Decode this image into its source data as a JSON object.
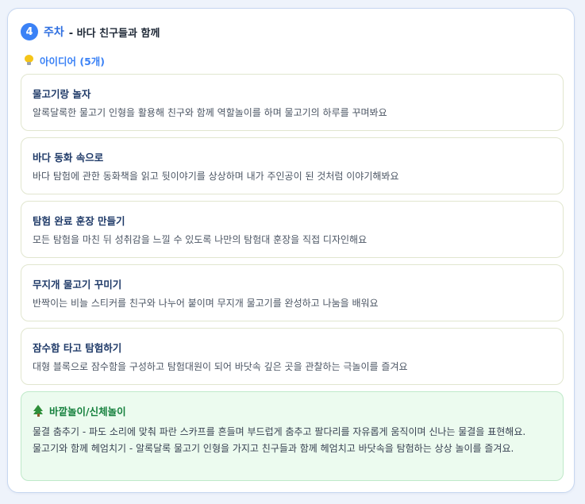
{
  "week": {
    "number": "4",
    "label": "주차",
    "title": "- 바다 친구들과 함께"
  },
  "ideas": {
    "header": "아이디어 (5개)",
    "icon": "lightbulb-icon",
    "items": [
      {
        "title": "물고기랑 놀자",
        "description": "알록달록한 물고기 인형을 활용해 친구와 함께 역할놀이를 하며 물고기의 하루를 꾸며봐요"
      },
      {
        "title": "바다 동화 속으로",
        "description": "바다 탐험에 관한 동화책을 읽고 뒷이야기를 상상하며 내가 주인공이 된 것처럼 이야기해봐요"
      },
      {
        "title": "탐험 완료 훈장 만들기",
        "description": "모든 탐험을 마친 뒤 성취감을 느낄 수 있도록 나만의 탐험대 훈장을 직접 디자인해요"
      },
      {
        "title": "무지개 물고기 꾸미기",
        "description": "반짝이는 비늘 스티커를 친구와 나누어 붙이며 무지개 물고기를 완성하고 나눔을 배워요"
      },
      {
        "title": "잠수함 타고 탐험하기",
        "description": "대형 블록으로 잠수함을 구성하고 탐험대원이 되어 바닷속 깊은 곳을 관찰하는 극놀이를 즐겨요"
      }
    ]
  },
  "play": {
    "icon": "tree-icon",
    "title": "바깥놀이/신체놀이",
    "lines": [
      "물결 춤추기 - 파도 소리에 맞춰 파란 스카프를 흔들며 부드럽게 춤추고 팔다리를 자유롭게 움직이며 신나는 물결을 표현해요.",
      "물고기와 함께 헤엄치기 - 알록달록 물고기 인형을 가지고 친구들과 함께 헤엄치고 바닷속을 탐험하는 상상 놀이를 즐겨요."
    ]
  },
  "colors": {
    "accent": "#3b82f6",
    "idea_title": "#1f3a68",
    "play_title": "#15803d",
    "play_background": "#ecfbef"
  }
}
